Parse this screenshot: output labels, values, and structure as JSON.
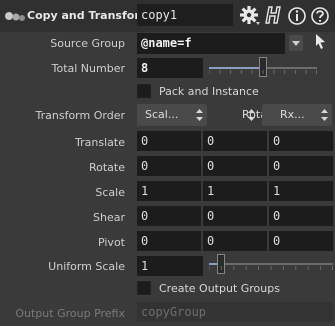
{
  "header": {
    "node_type": "Copy and Transform",
    "node_name": "copy1",
    "icons": [
      "copy-sop-icon",
      "gear-icon",
      "houdini-help-icon",
      "info-icon",
      "question-icon"
    ]
  },
  "params": {
    "source_group": {
      "label": "Source Group",
      "value": "@name=f"
    },
    "total_number": {
      "label": "Total Number",
      "value": "8",
      "slider_fraction": 0.5
    },
    "pack_and_instance": {
      "label": "Pack and Instance",
      "checked": false
    },
    "transform_order": {
      "label": "Transform Order",
      "menu1": "Scal...",
      "menu2": "Rota...",
      "menu3": "Rx..."
    },
    "translate": {
      "label": "Translate",
      "values": [
        "0",
        "0",
        "0"
      ]
    },
    "rotate": {
      "label": "Rotate",
      "values": [
        "0",
        "0",
        "0"
      ]
    },
    "scale": {
      "label": "Scale",
      "values": [
        "1",
        "1",
        "1"
      ]
    },
    "shear": {
      "label": "Shear",
      "values": [
        "0",
        "0",
        "0"
      ]
    },
    "pivot": {
      "label": "Pivot",
      "values": [
        "0",
        "0",
        "0"
      ]
    },
    "uniform_scale": {
      "label": "Uniform Scale",
      "value": "1",
      "slider_fraction": 0.1
    },
    "create_output_groups": {
      "label": "Create Output Groups",
      "checked": false
    },
    "output_group_prefix": {
      "label": "Output Group Prefix",
      "value": "copyGroup"
    }
  },
  "colors": {
    "background": "#3a3a3a",
    "field": "#1c1c1c",
    "slider_fill": "#8a9fc0"
  }
}
